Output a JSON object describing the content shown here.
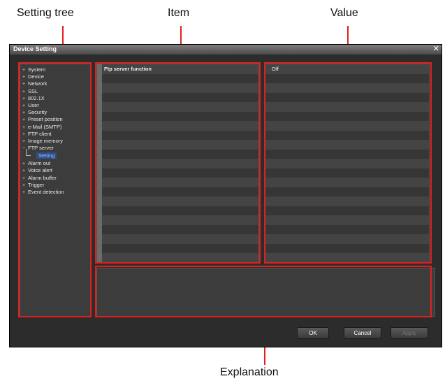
{
  "callouts": {
    "setting_tree": "Setting tree",
    "item": "Item",
    "value": "Value",
    "explanation": "Explanation"
  },
  "window": {
    "title": "Device Setting",
    "close_icon": "close-icon"
  },
  "tree": {
    "items": [
      {
        "label": "System",
        "expander": "+"
      },
      {
        "label": "Device",
        "expander": "+"
      },
      {
        "label": "Network",
        "expander": "+"
      },
      {
        "label": "SSL",
        "expander": "+"
      },
      {
        "label": "802.1X",
        "expander": "+"
      },
      {
        "label": "User",
        "expander": "+"
      },
      {
        "label": "Security",
        "expander": "+"
      },
      {
        "label": "Preset position",
        "expander": "+"
      },
      {
        "label": "e-Mail (SMTP)",
        "expander": "+"
      },
      {
        "label": "FTP client",
        "expander": "+"
      },
      {
        "label": "Image memory",
        "expander": "+"
      },
      {
        "label": "FTP server",
        "expander": "−"
      }
    ],
    "selected_child": "Setting",
    "items_after": [
      {
        "label": "Alarm out",
        "expander": "+"
      },
      {
        "label": "Voice alert",
        "expander": "+"
      },
      {
        "label": "Alarm buffer",
        "expander": "+"
      },
      {
        "label": "Trigger",
        "expander": "+"
      },
      {
        "label": "Event detection",
        "expander": "+"
      }
    ]
  },
  "grid": {
    "item_name": "Ftp server function",
    "value": "Off"
  },
  "buttons": {
    "ok": "OK",
    "cancel": "Cancel",
    "apply": "Apply"
  },
  "colors": {
    "highlight_red": "#e02020",
    "window_bg": "#2c2c2c",
    "selection_text": "#8fc0ff"
  }
}
